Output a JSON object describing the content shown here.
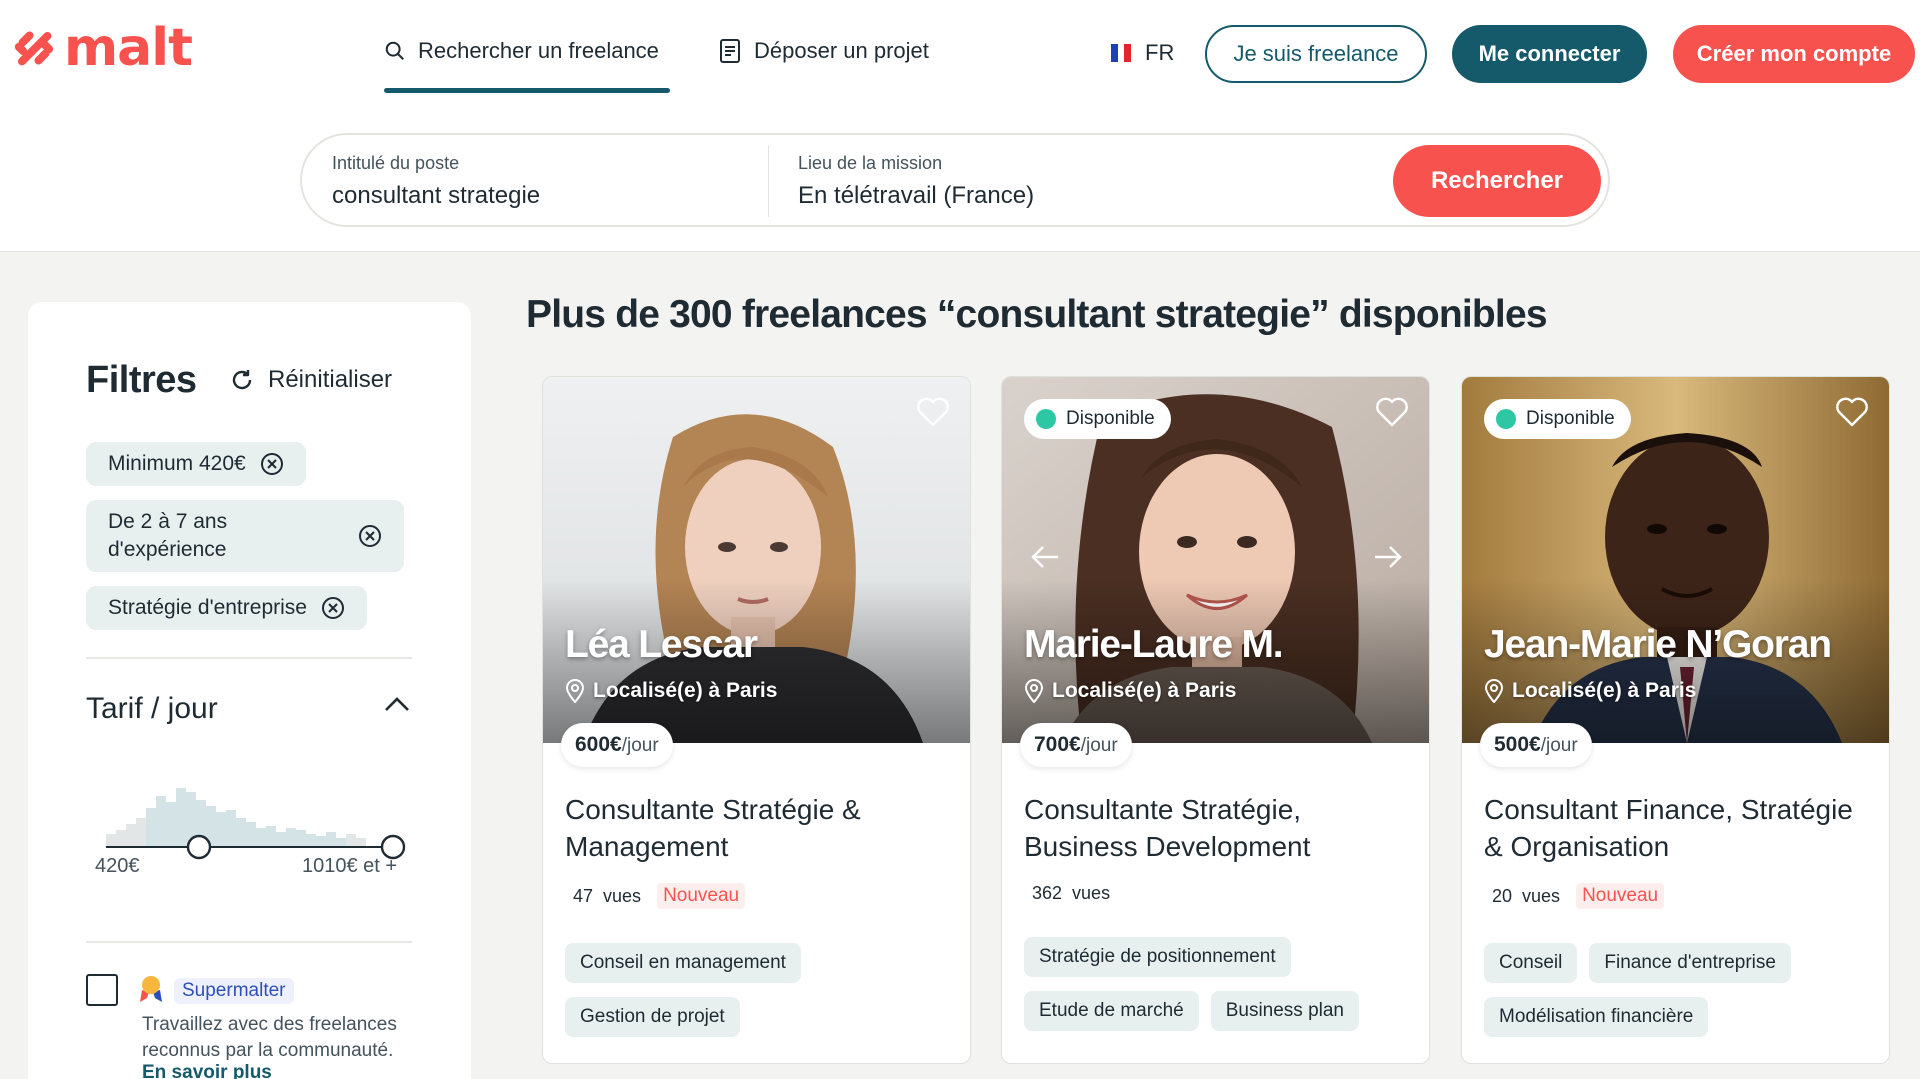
{
  "brand": {
    "name": "malt",
    "color": "#f8524f"
  },
  "nav": {
    "search_label": "Rechercher un freelance",
    "post_label": "Déposer un projet",
    "language": "FR",
    "freelance_button": "Je suis freelance",
    "login_button": "Me connecter",
    "signup_button": "Créer mon compte"
  },
  "search": {
    "job_label": "Intitulé du poste",
    "job_value": "consultant strategie",
    "location_label": "Lieu de la mission",
    "location_value": "En télétravail (France)",
    "button": "Rechercher"
  },
  "filters": {
    "title": "Filtres",
    "reset": "Réinitialiser",
    "chips": [
      "Minimum 420€",
      "De 2 à 7 ans d'expérience",
      "Stratégie d'entreprise"
    ],
    "rate_section": "Tarif / jour",
    "range_min": "420€",
    "range_max": "1010€ et +",
    "supermalter": {
      "label": "Supermalter",
      "description": "Travaillez avec des freelances reconnus par la communauté.",
      "link": "En savoir plus"
    }
  },
  "results": {
    "title": "Plus de 300 freelances “consultant strategie” disponibles"
  },
  "cards": [
    {
      "name": "Léa Lescar",
      "location": "Localisé(e) à Paris",
      "rate_amount": "600€",
      "rate_unit": "/jour",
      "title": "Consultante Stratégie & Management",
      "views_count": "47",
      "views_label": "vues",
      "new_badge": "Nouveau",
      "tags": [
        "Conseil en management",
        "Gestion de projet"
      ]
    },
    {
      "name": "Marie-Laure M.",
      "location": "Localisé(e) à Paris",
      "badge": "Disponible",
      "rate_amount": "700€",
      "rate_unit": "/jour",
      "title": "Consultante Stratégie, Business Development",
      "views_count": "362",
      "views_label": "vues",
      "tags": [
        "Stratégie de positionnement",
        "Etude de marché",
        "Business plan"
      ]
    },
    {
      "name": "Jean-Marie N’Goran",
      "location": "Localisé(e) à Paris",
      "badge": "Disponible",
      "rate_amount": "500€",
      "rate_unit": "/jour",
      "title": "Consultant Finance, Stratégie & Organisation",
      "views_count": "20",
      "views_label": "vues",
      "new_badge": "Nouveau",
      "tags": [
        "Conseil",
        "Finance d'entreprise",
        "Modélisation financière"
      ]
    }
  ]
}
